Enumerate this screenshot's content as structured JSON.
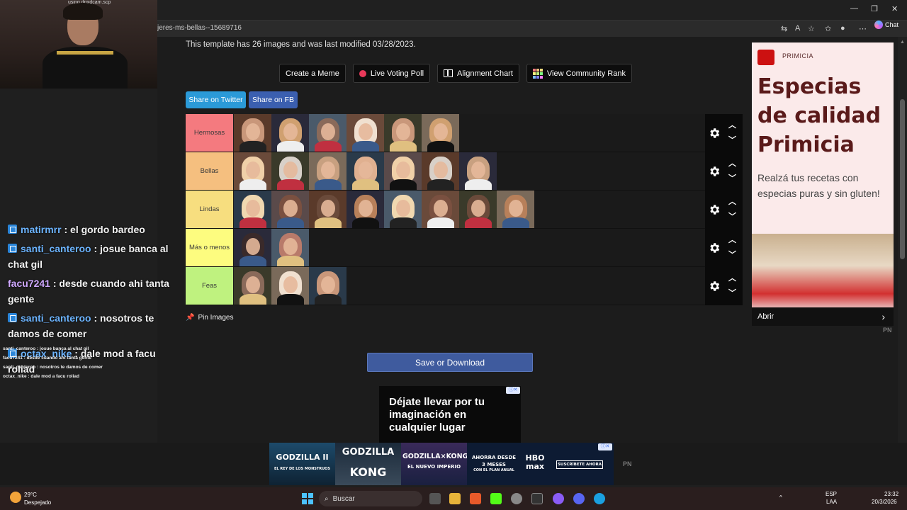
{
  "browser": {
    "url": "jeres-ms-bellas--15689716",
    "chat_label": "Chat"
  },
  "webcam": {
    "caption": "using droidcam.scp"
  },
  "template_info": "This template has 26 images and was last modified 03/28/2023.",
  "actions": {
    "create_meme": "Create a Meme",
    "live_poll": "Live Voting Poll",
    "alignment": "Alignment Chart",
    "community": "View Community Rank"
  },
  "share": {
    "twitter": "Share on Twitter",
    "fb": "Share on FB"
  },
  "tiers": [
    {
      "label": "Hermosas",
      "color": "#f47a7f",
      "count": 6
    },
    {
      "label": "Bellas",
      "color": "#f5bf7f",
      "count": 7
    },
    {
      "label": "Lindas",
      "color": "#f7de7f",
      "count": 8
    },
    {
      "label": "Más o menos",
      "color": "#fdfc7f",
      "count": 2
    },
    {
      "label": "Feas",
      "color": "#bff27f",
      "count": 3
    }
  ],
  "pin_images": "Pin Images",
  "save_download": "Save or Download",
  "ad_small": {
    "text": "Déjate llevar por tu imaginación en cualquier lugar"
  },
  "ad_right": {
    "brand": "PRIMICIA",
    "headline": "Especias de calidad Primicia",
    "sub": "Realzá tus recetas con especias puras y sin gluten!",
    "cta": "Abrir",
    "pn": "PN"
  },
  "ad_bottom": {
    "g1": "GODZILLA II",
    "g1s": "EL REY DE LOS MONSTRUOS",
    "g2a": "GODZILLA",
    "g2b": "KONG",
    "g3a": "GODZILLA×KONG",
    "g3b": "EL NUEVO IMPERIO",
    "promo": "AHORRA DESDE 3 MESES",
    "promo2": "CON EL PLAN ANUAL",
    "hbo": "HBO max",
    "cta": "SUSCRÍBETE AHORA",
    "pn": "PN"
  },
  "chat": [
    {
      "user": "matirmrr",
      "msg": " : el gordo bardeo",
      "color": "blue"
    },
    {
      "user": "santi_canteroo",
      "msg": " : josue banca al chat gil",
      "color": "blue"
    },
    {
      "user": "facu7241",
      "msg": " : desde cuando ahi tanta gente",
      "color": "purple"
    },
    {
      "user": "santi_canteroo",
      "msg": " : nosotros te damos de comer",
      "color": "blue"
    },
    {
      "user": "octax_nike",
      "msg": " : dale mod a facu roliad",
      "color": "blue"
    }
  ],
  "mini_chat": [
    "santi_canteroo : josue banca al chat gil",
    "facu7241 : desde cuando ahi tanta gente",
    "santi_canteroo : nosotros te damos de comer",
    "octax_nike : dale mod a facu roliad"
  ],
  "taskbar": {
    "temp": "29°C",
    "weather": "Despejado",
    "search": "Buscar",
    "lang": "ESP",
    "lang2": "LAA",
    "time": "23:32",
    "date": "20/3/2026"
  }
}
